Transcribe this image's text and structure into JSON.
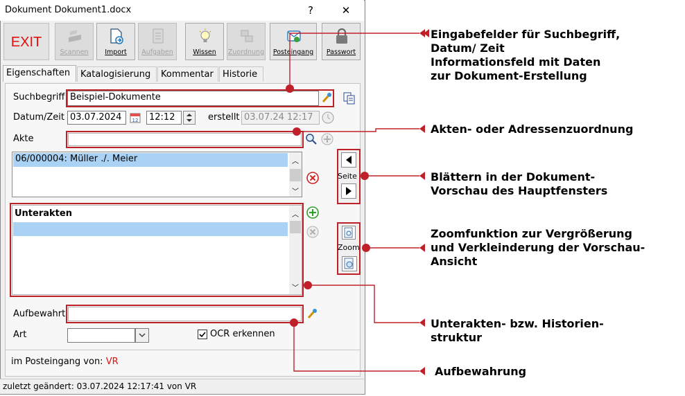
{
  "window": {
    "title": "Dokument Dokument1.docx",
    "help": "?",
    "close": "✕"
  },
  "toolbar": {
    "exit": "EXIT",
    "buttons": [
      {
        "label": "Scannen",
        "enabled": false,
        "icon": "scanner-icon"
      },
      {
        "label": "Import",
        "enabled": true,
        "icon": "import-icon"
      },
      {
        "label": "Aufgaben",
        "enabled": false,
        "icon": "tasks-icon"
      },
      {
        "label": "Wissen",
        "enabled": true,
        "icon": "lightbulb-icon"
      },
      {
        "label": "Zuordnung",
        "enabled": false,
        "icon": "assign-icon"
      },
      {
        "label": "Posteingang",
        "enabled": true,
        "icon": "inbox-mail-icon"
      },
      {
        "label": "Passwort",
        "enabled": true,
        "icon": "lock-icon"
      }
    ]
  },
  "tabs": [
    "Eigenschaften",
    "Katalogisierung",
    "Kommentar",
    "Historie"
  ],
  "form": {
    "suchbegriff_label": "Suchbegriff",
    "suchbegriff_value": "Beispiel-Dokumente",
    "datum_label": "Datum/Zeit",
    "datum_value": "03.07.2024",
    "zeit_value": "12:12",
    "erstellt_label": "erstellt",
    "erstellt_value": "03.07.24 12:17",
    "akte_label": "Akte",
    "akte_value": "",
    "akten_list": [
      "06/000004: Müller ./. Meier"
    ],
    "unterakten_header": "Unterakten",
    "aufbewahrt_label": "Aufbewahrt",
    "aufbewahrt_value": "",
    "art_label": "Art",
    "art_value": "",
    "ocr_label": "OCR erkennen",
    "ocr_checked": true,
    "posteingang_label": "im Posteingang von:",
    "posteingang_user": "VR",
    "seite_label": "Seite",
    "zoom_label": "Zoom"
  },
  "status": "zuletzt geändert: 03.07.2024 12:17:41 von VR",
  "callouts": [
    {
      "lines": [
        "Eingabefelder für Suchbegriff,",
        "Datum/ Zeit",
        "Informationsfeld mit Daten",
        "zur Dokument-Erstellung"
      ]
    },
    {
      "lines": [
        "Akten- oder Adressenzuordnung"
      ]
    },
    {
      "lines": [
        "Blättern in der Dokument-",
        "Vorschau des Hauptfensters"
      ]
    },
    {
      "lines": [
        "Zoomfunktion zur Vergrößerung",
        "und Verkleinderung der Vorschau-",
        "Ansicht"
      ]
    },
    {
      "lines": [
        "Unterakten- bzw. Historien-",
        "struktur"
      ]
    },
    {
      "lines": [
        "Aufbewahrung"
      ]
    }
  ],
  "colors": {
    "accent_red": "#c0202a",
    "exit_red": "#e01010",
    "selection": "#aad2f4"
  }
}
